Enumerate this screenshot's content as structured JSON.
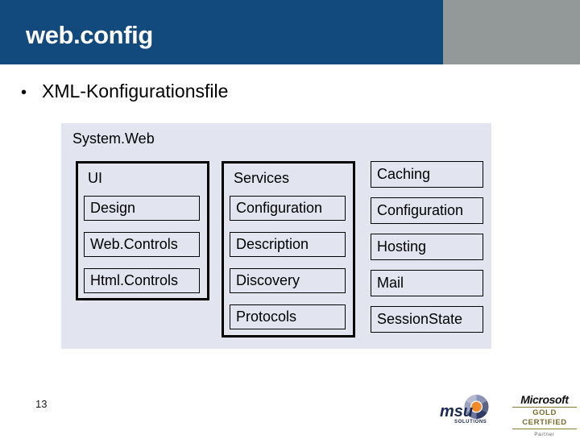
{
  "slide": {
    "title": "web.config",
    "page_number": "13",
    "accent_blue": "#124A7E",
    "header_gray": "#939899",
    "panel_bg": "#E2E5EF"
  },
  "bullets": [
    {
      "marker": "•",
      "text": "XML-Konfigurationsfile"
    }
  ],
  "diagram": {
    "title": "System.Web",
    "groups": [
      {
        "id": "ui",
        "label": "UI",
        "boxed": true,
        "items": [
          "Design",
          "Web.Controls",
          "Html.Controls"
        ]
      },
      {
        "id": "services",
        "label": "Services",
        "boxed": true,
        "items": [
          "Configuration",
          "Description",
          "Discovery",
          "Protocols"
        ]
      },
      {
        "id": "caching",
        "label": "Caching",
        "boxed": false,
        "items": [
          "Caching",
          "Configuration",
          "Hosting",
          "Mail",
          "SessionState"
        ]
      }
    ]
  },
  "footer": {
    "msu_logo": {
      "name": "msu",
      "tagline": "SOLUTIONS"
    },
    "microsoft_logo": {
      "brand": "Microsoft",
      "certification": "GOLD CERTIFIED",
      "tier": "Partner"
    }
  }
}
